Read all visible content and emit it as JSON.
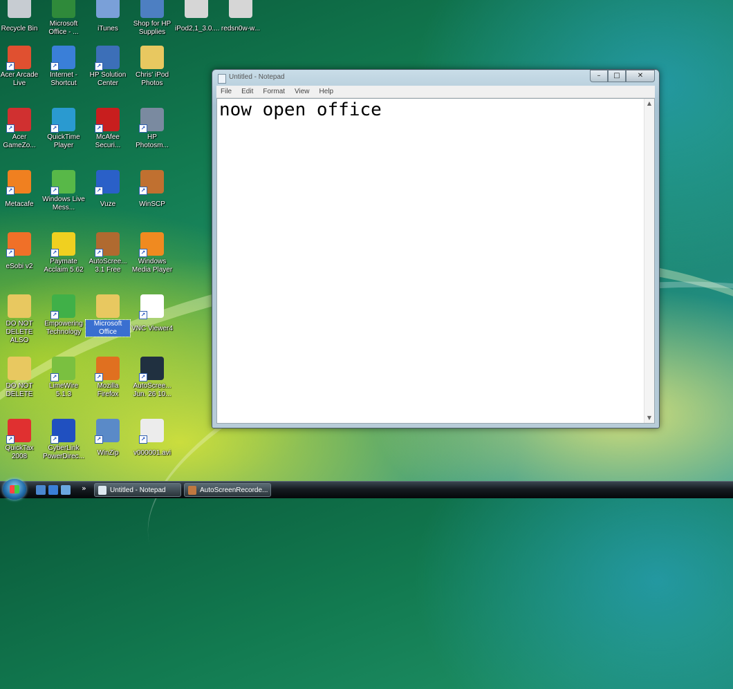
{
  "desktop": {
    "icons": [
      {
        "label": "Recycle Bin",
        "icon": "recycle-bin-icon",
        "color": "#c7ccd2"
      },
      {
        "label": "Microsoft Office - ...",
        "icon": "office-icon",
        "color": "#2f8a3a"
      },
      {
        "label": "iTunes",
        "icon": "itunes-icon",
        "color": "#7aa0d8"
      },
      {
        "label": "Shop for HP Supplies",
        "icon": "hp-shop-icon",
        "color": "#4d7fc2"
      },
      {
        "label": "iPod2,1_3.0....",
        "icon": "file-icon",
        "color": "#d6d6d6"
      },
      {
        "label": "redsn0w-w...",
        "icon": "file-icon",
        "color": "#d6d6d6"
      },
      {
        "label": "Acer Arcade Live",
        "icon": "acer-arcade-icon",
        "color": "#e05030"
      },
      {
        "label": "Internet - Shortcut",
        "icon": "internet-explorer-icon",
        "color": "#3a7fd8"
      },
      {
        "label": "HP Solution Center",
        "icon": "hp-icon",
        "color": "#3c6fb8"
      },
      {
        "label": "Chris' iPod Photos",
        "icon": "folder-icon",
        "color": "#e8c860"
      },
      {
        "label": "Acer GameZo...",
        "icon": "cube-icon",
        "color": "#d03030"
      },
      {
        "label": "QuickTime Player",
        "icon": "quicktime-icon",
        "color": "#2a9ad0"
      },
      {
        "label": "McAfee Securi...",
        "icon": "mcafee-icon",
        "color": "#c81e1e"
      },
      {
        "label": "HP Photosm...",
        "icon": "hp-photo-icon",
        "color": "#7a8aa0"
      },
      {
        "label": "Metacafe",
        "icon": "metacafe-icon",
        "color": "#f08020"
      },
      {
        "label": "Windows Live Mess...",
        "icon": "messenger-icon",
        "color": "#58b848"
      },
      {
        "label": "Vuze",
        "icon": "vuze-icon",
        "color": "#2a60c8"
      },
      {
        "label": "WinSCP",
        "icon": "winscp-icon",
        "color": "#c07030"
      },
      {
        "label": "eSobi v2",
        "icon": "esobi-icon",
        "color": "#f07028"
      },
      {
        "label": "Paymate Acclaim 5.62",
        "icon": "paymate-icon",
        "color": "#f0d020"
      },
      {
        "label": "AutoScree... 3.1 Free",
        "icon": "film-reel-icon",
        "color": "#b06a30"
      },
      {
        "label": "Windows Media Player",
        "icon": "media-player-icon",
        "color": "#f08a20"
      },
      {
        "label": "DO NOT DELETE ALSO",
        "icon": "folder-icon",
        "color": "#e8c860"
      },
      {
        "label": "Empowering Technology",
        "icon": "empowering-icon",
        "color": "#40b048"
      },
      {
        "label": "Microsoft Office",
        "icon": "folder-icon",
        "color": "#e8c860"
      },
      {
        "label": "VNC Viewer4",
        "icon": "vnc-icon",
        "color": "#ffffff"
      },
      {
        "label": "DO NOT DELETE",
        "icon": "folder-icon",
        "color": "#e8c860"
      },
      {
        "label": "LimeWire 5.1.3",
        "icon": "limewire-icon",
        "color": "#7ac040"
      },
      {
        "label": "Mozilla Firefox",
        "icon": "firefox-icon",
        "color": "#e07020"
      },
      {
        "label": "AutoScree... Jun. 26 10...",
        "icon": "video-icon",
        "color": "#203040"
      },
      {
        "label": "QuickTax 2008",
        "icon": "quicktax-icon",
        "color": "#e03030"
      },
      {
        "label": "CyberLink PowerDirec...",
        "icon": "powerdirector-icon",
        "color": "#2050c0"
      },
      {
        "label": "WinZip",
        "icon": "winzip-icon",
        "color": "#5a8ac8"
      },
      {
        "label": "v000001.avi",
        "icon": "avi-file-icon",
        "color": "#ececec"
      }
    ]
  },
  "notepad": {
    "title": "Untitled - Notepad",
    "menu": [
      "File",
      "Edit",
      "Format",
      "View",
      "Help"
    ],
    "content": "now open office",
    "buttons": {
      "minimize": "–",
      "maximize": "□",
      "close": "✕"
    }
  },
  "taskbar": {
    "items": [
      {
        "label": "Untitled - Notepad",
        "icon": "notepad-icon",
        "color": "#dde8f0"
      },
      {
        "label": "AutoScreenRecorde...",
        "icon": "film-reel-icon",
        "color": "#c07840"
      }
    ],
    "quicklaunch": [
      {
        "icon": "show-desktop-icon",
        "color": "#4a88d0"
      },
      {
        "icon": "internet-explorer-icon",
        "color": "#3a7fd8"
      },
      {
        "icon": "switch-windows-icon",
        "color": "#6aa8e0"
      }
    ],
    "overflow": "»"
  }
}
